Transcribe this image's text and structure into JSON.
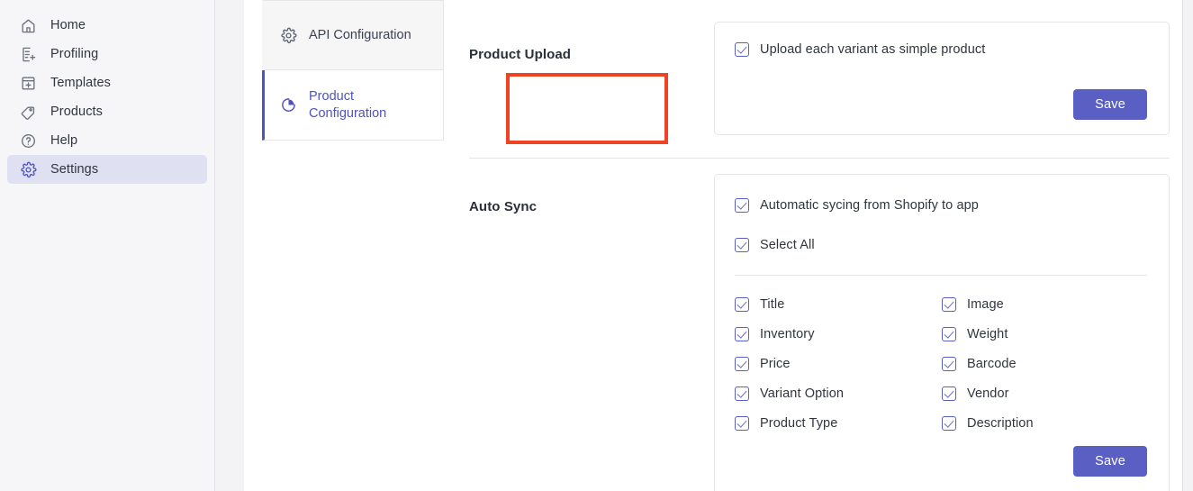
{
  "sidebar": {
    "items": [
      {
        "label": "Home",
        "icon": "home-icon",
        "active": false
      },
      {
        "label": "Profiling",
        "icon": "document-add-icon",
        "active": false
      },
      {
        "label": "Templates",
        "icon": "template-add-icon",
        "active": false
      },
      {
        "label": "Products",
        "icon": "tag-icon",
        "active": false
      },
      {
        "label": "Help",
        "icon": "question-circle-icon",
        "active": false
      },
      {
        "label": "Settings",
        "icon": "gear-icon",
        "active": true
      }
    ]
  },
  "tabs": [
    {
      "label": "API Configuration",
      "icon": "gear-icon",
      "active": false
    },
    {
      "label": "Product Configuration",
      "icon": "pie-chart-icon",
      "active": true
    }
  ],
  "annotation": {
    "type": "highlight-rectangle",
    "color": "#ef4423",
    "target": "Product Configuration"
  },
  "sections": {
    "product_upload": {
      "title": "Product Upload",
      "checkbox": {
        "label": "Upload each variant as simple product",
        "checked": true
      },
      "save_label": "Save"
    },
    "auto_sync": {
      "title": "Auto Sync",
      "automatic_sync": {
        "label": "Automatic sycing from Shopify to app",
        "checked": true
      },
      "select_all": {
        "label": "Select All",
        "checked": true
      },
      "fields": [
        {
          "label": "Title",
          "checked": true
        },
        {
          "label": "Image",
          "checked": true
        },
        {
          "label": "Inventory",
          "checked": true
        },
        {
          "label": "Weight",
          "checked": true
        },
        {
          "label": "Price",
          "checked": true
        },
        {
          "label": "Barcode",
          "checked": true
        },
        {
          "label": "Variant Option",
          "checked": true
        },
        {
          "label": "Vendor",
          "checked": true
        },
        {
          "label": "Product Type",
          "checked": true
        },
        {
          "label": "Description",
          "checked": true
        }
      ],
      "save_label": "Save"
    }
  },
  "colors": {
    "accent": "#5a5fc4",
    "accent_active_text": "#4f53ba",
    "sidebar_active_bg": "#dfe0f2",
    "annotation": "#ef4423",
    "sidebar_bg": "#f6f6f8",
    "card_border": "#e6e6e9"
  }
}
